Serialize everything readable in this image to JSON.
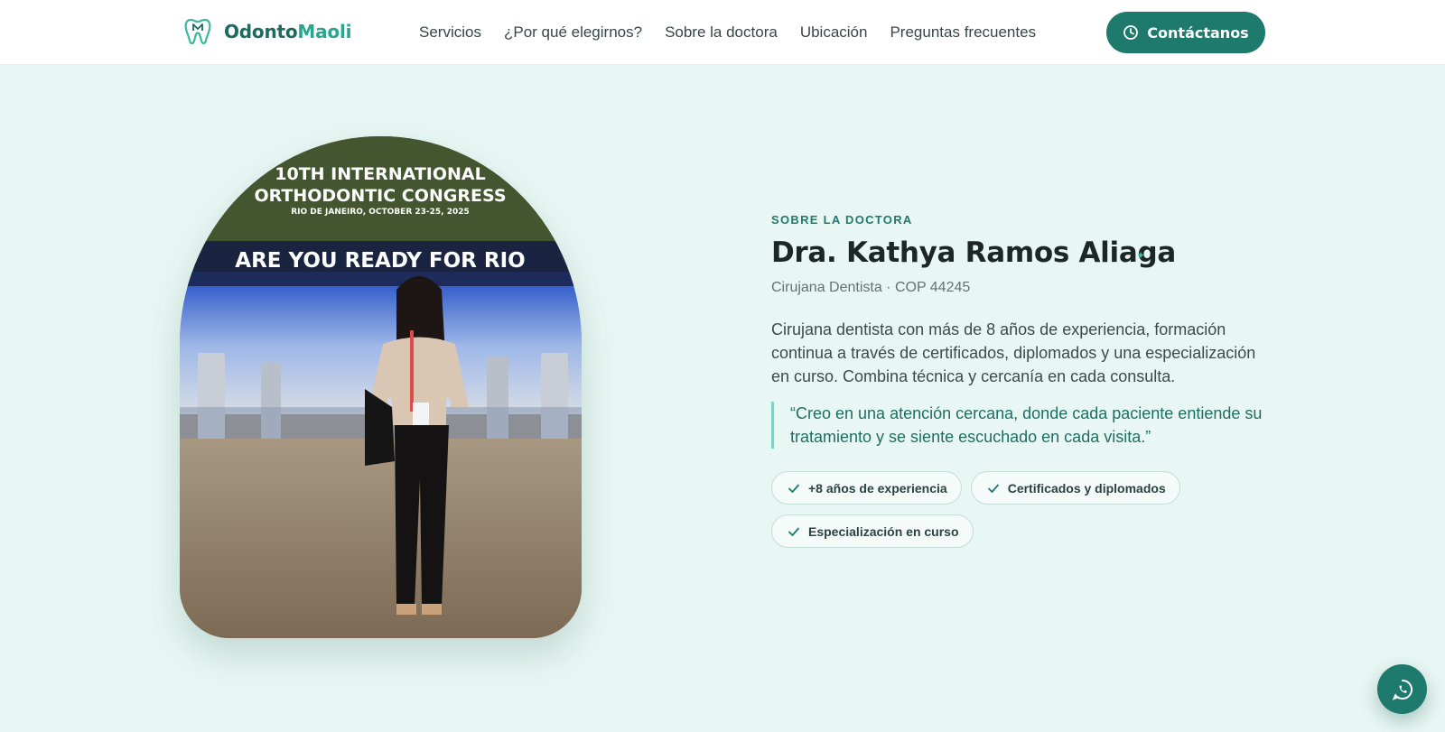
{
  "header": {
    "brand": {
      "part_a": "Odonto",
      "part_b": "Maoli",
      "logo_icon": "tooth-logo-icon"
    },
    "nav": [
      {
        "label": "Servicios"
      },
      {
        "label": "¿Por qué elegirnos?"
      },
      {
        "label": "Sobre la doctora"
      },
      {
        "label": "Ubicación"
      },
      {
        "label": "Preguntas frecuentes"
      }
    ],
    "cta": {
      "label": "Contáctanos",
      "icon": "clock-icon"
    }
  },
  "about": {
    "eyebrow": "SOBRE LA DOCTORA",
    "title": "Dra. Kathya Ramos Aliaga",
    "subtitle": "Cirujana Dentista · COP 44245",
    "description": "Cirujana dentista con más de 8 años de experiencia, formación continua a través de certificados, diplomados y una especialización en curso. Combina técnica y cercanía en cada consulta.",
    "quote": "“Creo en una atención cercana, donde cada paciente entiende su tratamiento y se siente escuchado en cada visita.”",
    "chips": [
      {
        "label": "+8 años de experiencia",
        "icon": "check-icon"
      },
      {
        "label": "Certificados y diplomados",
        "icon": "check-icon"
      },
      {
        "label": "Especialización en curso",
        "icon": "check-icon"
      }
    ],
    "photo": {
      "banner_line1": "10TH INTERNATIONAL",
      "banner_line2": "ORTHODONTIC CONGRESS",
      "banner_line3": "RIO DE JANEIRO, OCTOBER 23-25, 2025",
      "sign": "ARE YOU READY FOR RIO"
    }
  },
  "floating": {
    "icon": "whatsapp-icon"
  },
  "colors": {
    "accent": "#1e7a6c",
    "accent_light": "#2aa58f",
    "background": "#e8f7f3"
  }
}
